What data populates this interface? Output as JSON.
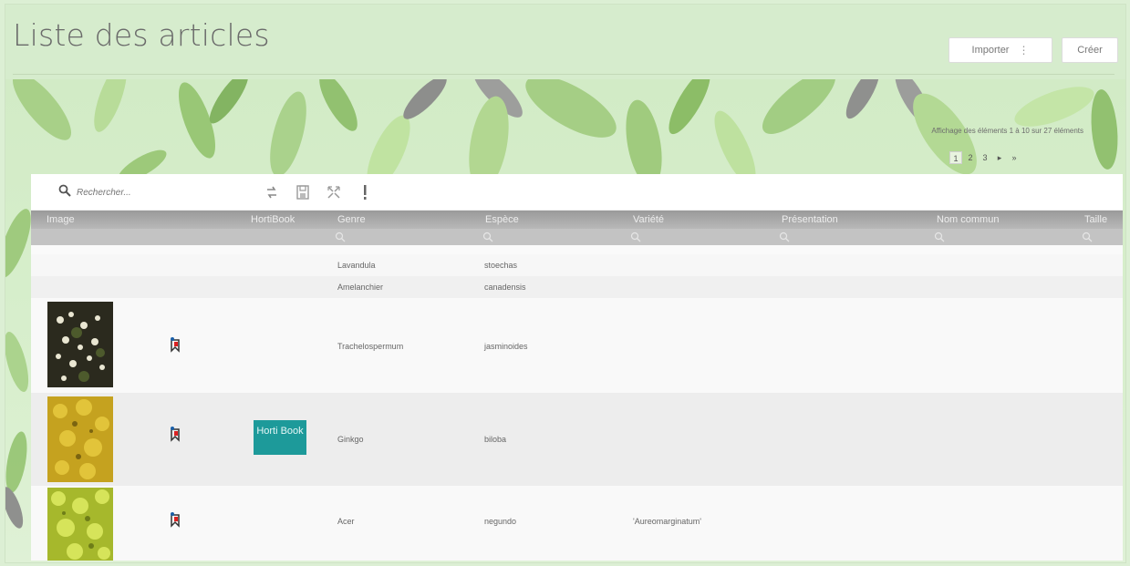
{
  "page": {
    "title": "Liste des articles",
    "import_label": "Importer",
    "create_label": "Créer"
  },
  "pagination": {
    "info": "Affichage des éléments 1 à 10 sur 27 éléments",
    "pages": [
      "1",
      "2",
      "3",
      "▸",
      "»"
    ]
  },
  "search": {
    "placeholder": "Rechercher..."
  },
  "columns": [
    "Image",
    "HortiBook",
    "Genre",
    "Espèce",
    "Variété",
    "Présentation",
    "Nom commun",
    "Taille"
  ],
  "rows": [
    {
      "genre": "Lavandula",
      "espece": "stoechas",
      "variete": ""
    },
    {
      "genre": "Amelanchier",
      "espece": "canadensis",
      "variete": ""
    },
    {
      "genre": "Trachelospermum",
      "espece": "jasminoides",
      "variete": ""
    },
    {
      "genre": "Ginkgo",
      "espece": "biloba",
      "variete": "",
      "hortibook": "Horti Book"
    },
    {
      "genre": "Acer",
      "espece": "negundo",
      "variete": "'Aureomarginatum'"
    }
  ],
  "colors": {
    "accent": "#1d9a9a",
    "header": "#a8a8a8",
    "background": "#d9eed0"
  },
  "icons": {
    "search": "search-icon",
    "bookmark": "bookmark-icon"
  }
}
